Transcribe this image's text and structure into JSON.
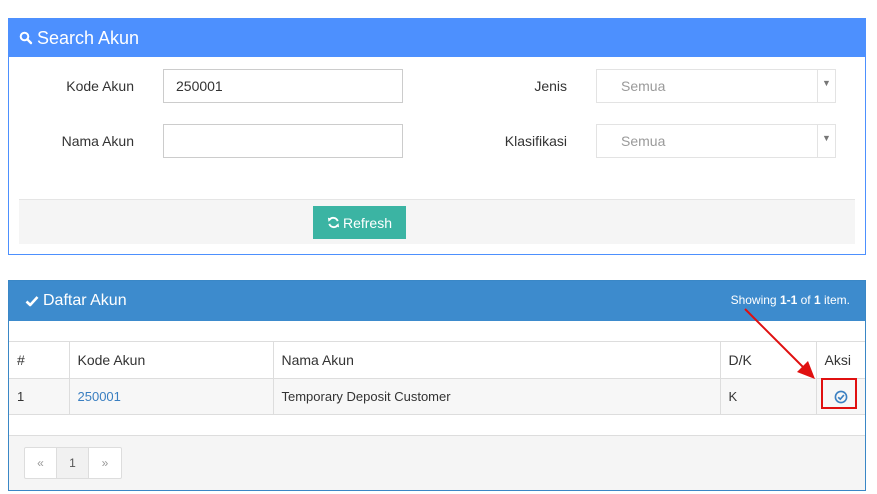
{
  "search_panel": {
    "title": "Search Akun",
    "icon": "search-icon",
    "kode_akun_label": "Kode Akun",
    "kode_akun_value": "250001",
    "nama_akun_label": "Nama Akun",
    "nama_akun_value": "",
    "jenis_label": "Jenis",
    "jenis_value": "Semua",
    "klasifikasi_label": "Klasifikasi",
    "klasifikasi_value": "Semua",
    "refresh_label": "Refresh",
    "refresh_icon": "refresh-icon"
  },
  "list_panel": {
    "title": "Daftar Akun",
    "icon": "check-icon",
    "summary_prefix": "Showing ",
    "summary_range": "1-1",
    "summary_of": " of ",
    "summary_total": "1",
    "summary_suffix": " item.",
    "columns": [
      "#",
      "Kode Akun",
      "Nama Akun",
      "D/K",
      "Aksi"
    ],
    "rows": [
      {
        "no": "1",
        "kode": "250001",
        "nama": "Temporary Deposit Customer",
        "dk": "K",
        "action_icon": "select-check-icon"
      }
    ],
    "pagination": {
      "prev": "«",
      "page": "1",
      "next": "»"
    }
  },
  "colors": {
    "search_header": "#4d90fe",
    "list_header": "#3d8bcd",
    "refresh_button": "#3bb4a3",
    "annotation": "#e01010",
    "link": "#3a7fc1"
  }
}
